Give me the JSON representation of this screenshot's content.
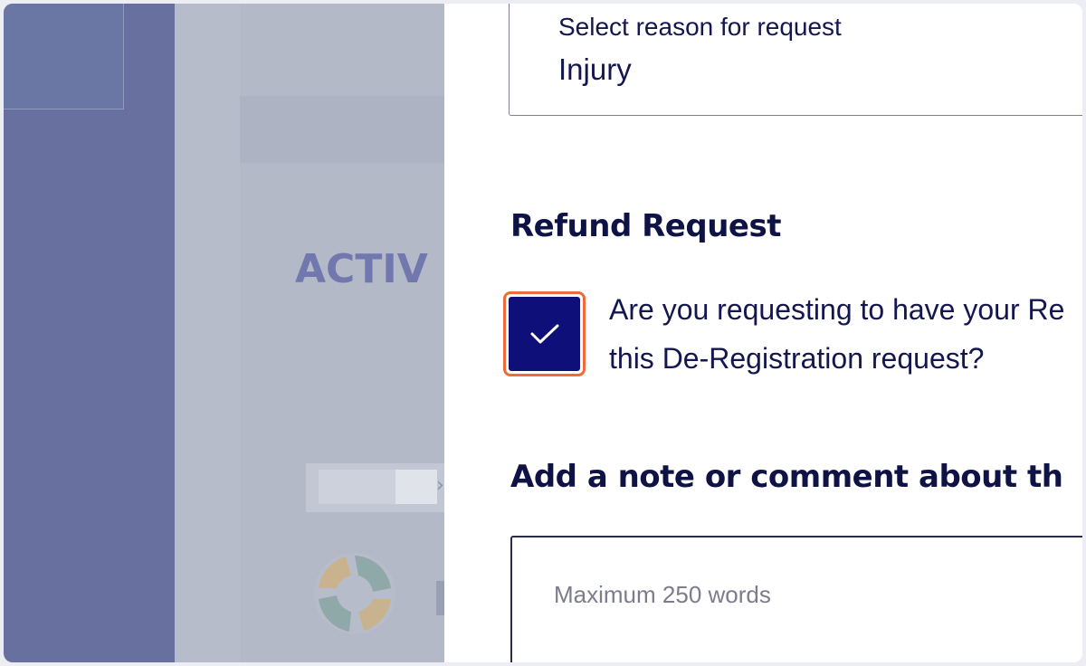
{
  "background": {
    "page_heading_fragment": "ACTIV",
    "colors": {
      "sidebar": "#67709f",
      "overlay": "#b4b9c8",
      "heading": "#7178ad"
    },
    "logo_icon": "ball-logo-icon"
  },
  "panel": {
    "reason_select": {
      "label": "Select reason for request",
      "value": "Injury"
    },
    "refund": {
      "heading": "Refund Request",
      "checkbox_checked": true,
      "question_line1": "Are you requesting to have your Re",
      "question_line2": "this De-Registration request?",
      "checkbox_icon": "check-icon"
    },
    "note": {
      "heading": "Add a note or comment about th",
      "placeholder": "Maximum 250 words",
      "value": ""
    },
    "colors": {
      "accent_navy": "#0f0f7a",
      "focus_ring": "#f06a3a",
      "text": "#14174f"
    }
  }
}
